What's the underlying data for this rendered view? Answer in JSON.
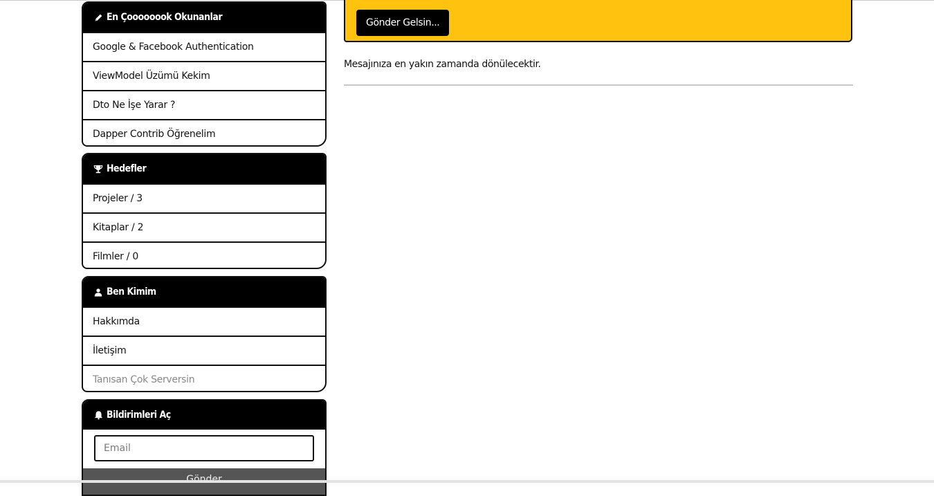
{
  "sidebar": {
    "popular": {
      "title": "En Çoooooook Okunanlar",
      "icon": "pencil-icon",
      "items": [
        {
          "label": "Google & Facebook Authentication"
        },
        {
          "label": "ViewModel Üzümü Kekim"
        },
        {
          "label": "Dto Ne İşe Yarar ?"
        },
        {
          "label": "Dapper Contrib Öğrenelim"
        }
      ]
    },
    "goals": {
      "title": "Hedefler",
      "icon": "trophy-icon",
      "items": [
        {
          "label": "Projeler / 3"
        },
        {
          "label": "Kitaplar / 2"
        },
        {
          "label": "Filmler / 0"
        }
      ]
    },
    "about": {
      "title": "Ben Kimim",
      "icon": "user-icon",
      "items": [
        {
          "label": "Hakkımda"
        },
        {
          "label": "İletişim"
        },
        {
          "label": "Tanısan Çok Serversin"
        }
      ]
    },
    "notifications": {
      "title": "Bildirimleri Aç",
      "icon": "bell-icon",
      "email_placeholder": "Email",
      "email_value": "",
      "send_label": "Gönder"
    }
  },
  "main": {
    "submit_label": "Gönder Gelsin...",
    "confirmation": "Mesajınıza en yakın zamanda dönülecektir.",
    "accent_color": "#FFC20E"
  }
}
